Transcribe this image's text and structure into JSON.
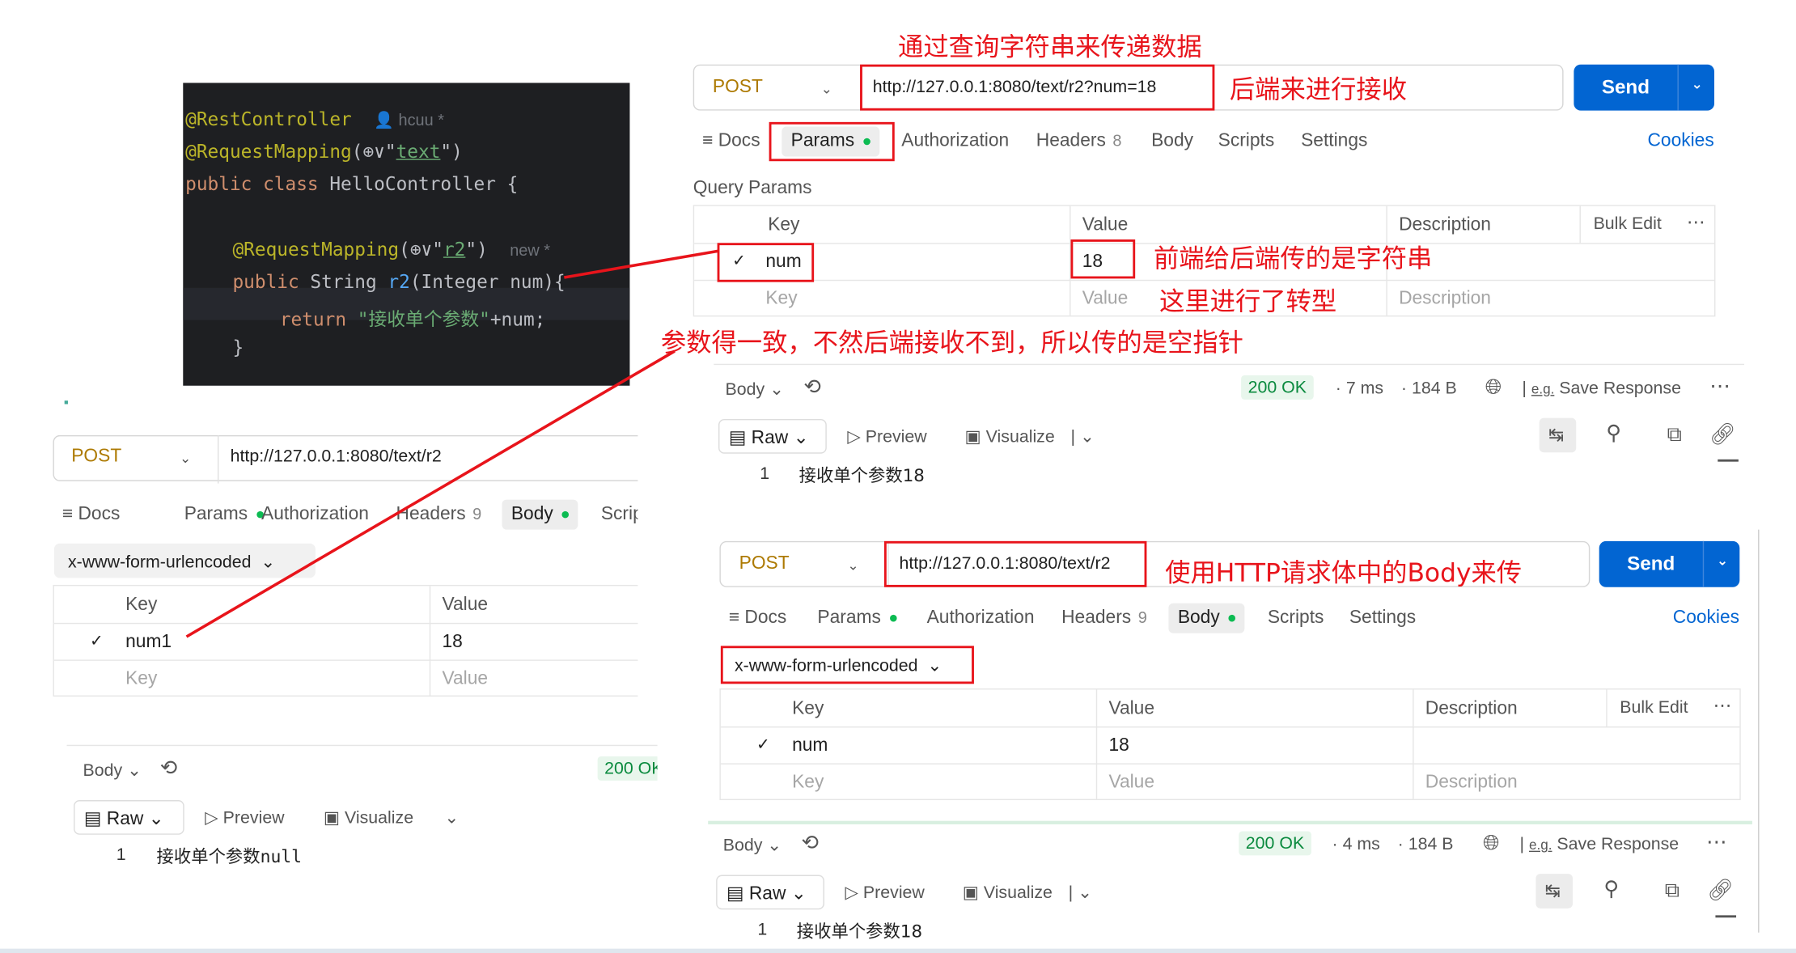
{
  "code": {
    "l1_ann": "@RestController",
    "l1_meta": "👤 hcuu *",
    "l2_ann": "@RequestMapping",
    "l2_mid": "(⊕∨\"",
    "l2_str": "text",
    "l2_end": "\")",
    "l3_kw": "public class ",
    "l3_rest": "HelloController {",
    "l5_ann": "@RequestMapping",
    "l5_mid": "(⊕∨\"",
    "l5_str": "r2",
    "l5_end": "\")",
    "l5_meta": "new *",
    "l6_kw": "public ",
    "l6_t": "String ",
    "l6_fn": "r2",
    "l6_rest": "(Integer num){",
    "l7_kw": "return ",
    "l7_str": "\"接收单个参数\"",
    "l7_rest": "+num;",
    "l8": "}"
  },
  "tr": {
    "method": "POST",
    "url": "http://127.0.0.1:8080/text/r2?num=18",
    "send": "Send",
    "tabs": {
      "docs": "Docs",
      "params": "Params",
      "auth": "Authorization",
      "headers": "Headers",
      "headers_count": "8",
      "body": "Body",
      "scripts": "Scripts",
      "settings": "Settings",
      "cookies": "Cookies"
    },
    "qp_title": "Query Params",
    "table": {
      "key": "Key",
      "value": "Value",
      "desc": "Description",
      "bulk": "Bulk Edit",
      "row_key": "num",
      "row_value": "18"
    },
    "resp": {
      "body": "Body",
      "status": "200 OK",
      "time": "7 ms",
      "size": "184 B",
      "save": "Save Response",
      "raw": "Raw",
      "preview": "Preview",
      "visualize": "Visualize",
      "line_no": "1",
      "content": "接收单个参数18"
    }
  },
  "br": {
    "method": "POST",
    "url": "http://127.0.0.1:8080/text/r2",
    "send": "Send",
    "tabs": {
      "docs": "Docs",
      "params": "Params",
      "auth": "Authorization",
      "headers": "Headers",
      "headers_count": "9",
      "body": "Body",
      "scripts": "Scripts",
      "settings": "Settings",
      "cookies": "Cookies"
    },
    "body_type": "x-www-form-urlencoded",
    "table": {
      "key": "Key",
      "value": "Value",
      "desc": "Description",
      "bulk": "Bulk Edit",
      "row_key": "num",
      "row_value": "18"
    },
    "resp": {
      "body": "Body",
      "status": "200 OK",
      "time": "4 ms",
      "size": "184 B",
      "save": "Save Response",
      "raw": "Raw",
      "preview": "Preview",
      "visualize": "Visualize",
      "line_no": "1",
      "content": "接收单个参数18"
    }
  },
  "lt": {
    "method": "POST",
    "url": "http://127.0.0.1:8080/text/r2",
    "tabs": {
      "docs": "Docs",
      "params": "Params",
      "auth": "Authorization",
      "headers": "Headers",
      "headers_count": "9",
      "body": "Body",
      "scripts": "Scripts"
    },
    "body_type": "x-www-form-urlencoded",
    "table": {
      "key": "Key",
      "value": "Value",
      "row_key": "num1",
      "row_value": "18"
    },
    "resp": {
      "body": "Body",
      "status": "200 OK",
      "raw": "Raw",
      "preview": "Preview",
      "visualize": "Visualize",
      "line_no": "1",
      "content": "接收单个参数null"
    }
  },
  "notes": {
    "title": "通过查询字符串来传递数据",
    "backend_recv": "后端来进行接收",
    "string": "前端给后端传的是字符串",
    "convert": "这里进行了转型",
    "mismatch": "参数得一致，不然后端接收不到，所以传的是空指针",
    "body": "使用HTTP请求体中的Body来传"
  },
  "colors": {
    "accent": "#0265d2",
    "annotation": "#e8141b",
    "method": "#ad7a03",
    "status_ok": "#0a8a3e"
  }
}
